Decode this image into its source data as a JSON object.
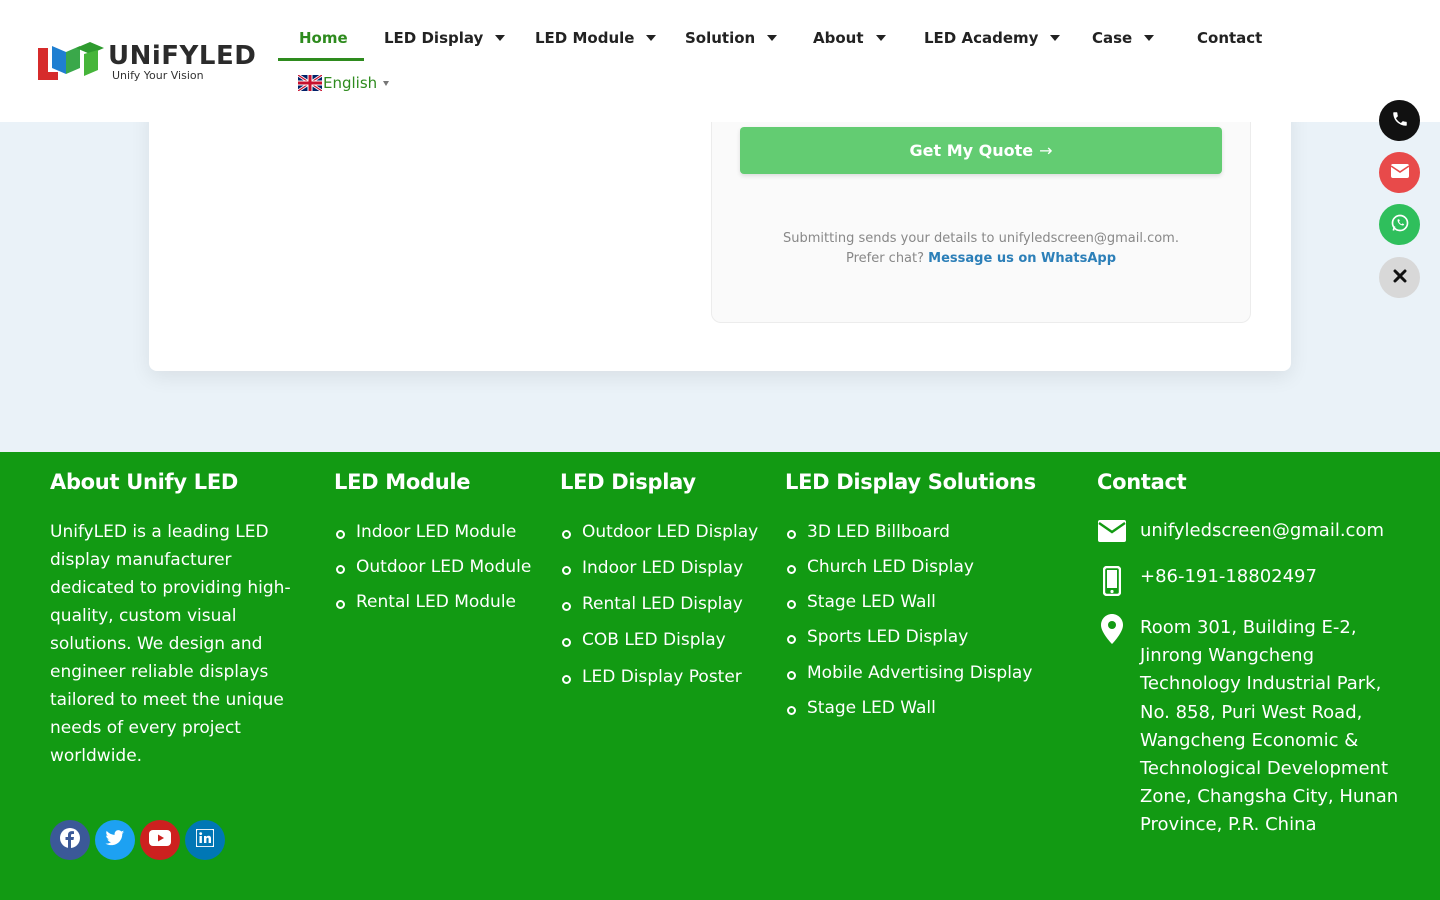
{
  "brand": {
    "name": "UNiFYLED",
    "tagline": "Unify Your Vision"
  },
  "nav": {
    "items": [
      {
        "label": "Home",
        "active": true
      },
      {
        "label": "LED Display"
      },
      {
        "label": "LED Module"
      },
      {
        "label": "Solution"
      },
      {
        "label": "About"
      },
      {
        "label": "LED Academy"
      },
      {
        "label": "Case"
      },
      {
        "label": "Contact"
      }
    ],
    "language": "English"
  },
  "form": {
    "submit_label": "Get My Quote",
    "submit_arrow": "→",
    "note_line1": "Submitting sends your details to unifyledscreen@gmail.com.",
    "note_line2_prefix": "Prefer chat?",
    "note_line2_link": "Message us on WhatsApp"
  },
  "floating": [
    "phone-icon",
    "envelope-icon",
    "whatsapp-icon",
    "close-icon"
  ],
  "footer": {
    "about": {
      "title": "About Unify LED",
      "text": "UnifyLED is a leading LED display manufacturer dedicated to providing high-quality, custom visual solutions. We design and engineer reliable displays tailored to meet the unique needs of every project worldwide."
    },
    "led_module": {
      "title": "LED Module",
      "items": [
        "Indoor LED Module",
        "Outdoor LED Module",
        "Rental LED Module"
      ]
    },
    "led_display": {
      "title": "LED Display",
      "items": [
        "Outdoor LED Display",
        "Indoor LED Display",
        "Rental LED Display",
        "COB LED Display",
        "LED Display Poster"
      ]
    },
    "solutions": {
      "title": "LED Display Solutions",
      "items": [
        "3D LED Billboard",
        "Church LED Display",
        "Stage LED Wall",
        "Sports LED Display",
        "Mobile Advertising Display",
        "Stage LED Wall"
      ]
    },
    "contact": {
      "title": "Contact",
      "email": "unifyledscreen@gmail.com",
      "phone": "+86-191-18802497",
      "address": "Room 301, Building E-2, Jinrong Wangcheng Technology Industrial Park, No. 858, Puri West Road, Wangcheng Economic & Technological Development Zone, Changsha City, Hunan Province, P.R. China"
    },
    "social": [
      {
        "icon": "facebook-icon",
        "color": "#3b5998"
      },
      {
        "icon": "twitter-icon",
        "color": "#1da1f2"
      },
      {
        "icon": "youtube-icon",
        "color": "#cd201f"
      },
      {
        "icon": "linkedin-icon",
        "color": "#0077b5"
      }
    ]
  },
  "colors": {
    "green": "#129a13",
    "accent_green": "#2e8b1e",
    "button_green": "#63cc72"
  }
}
